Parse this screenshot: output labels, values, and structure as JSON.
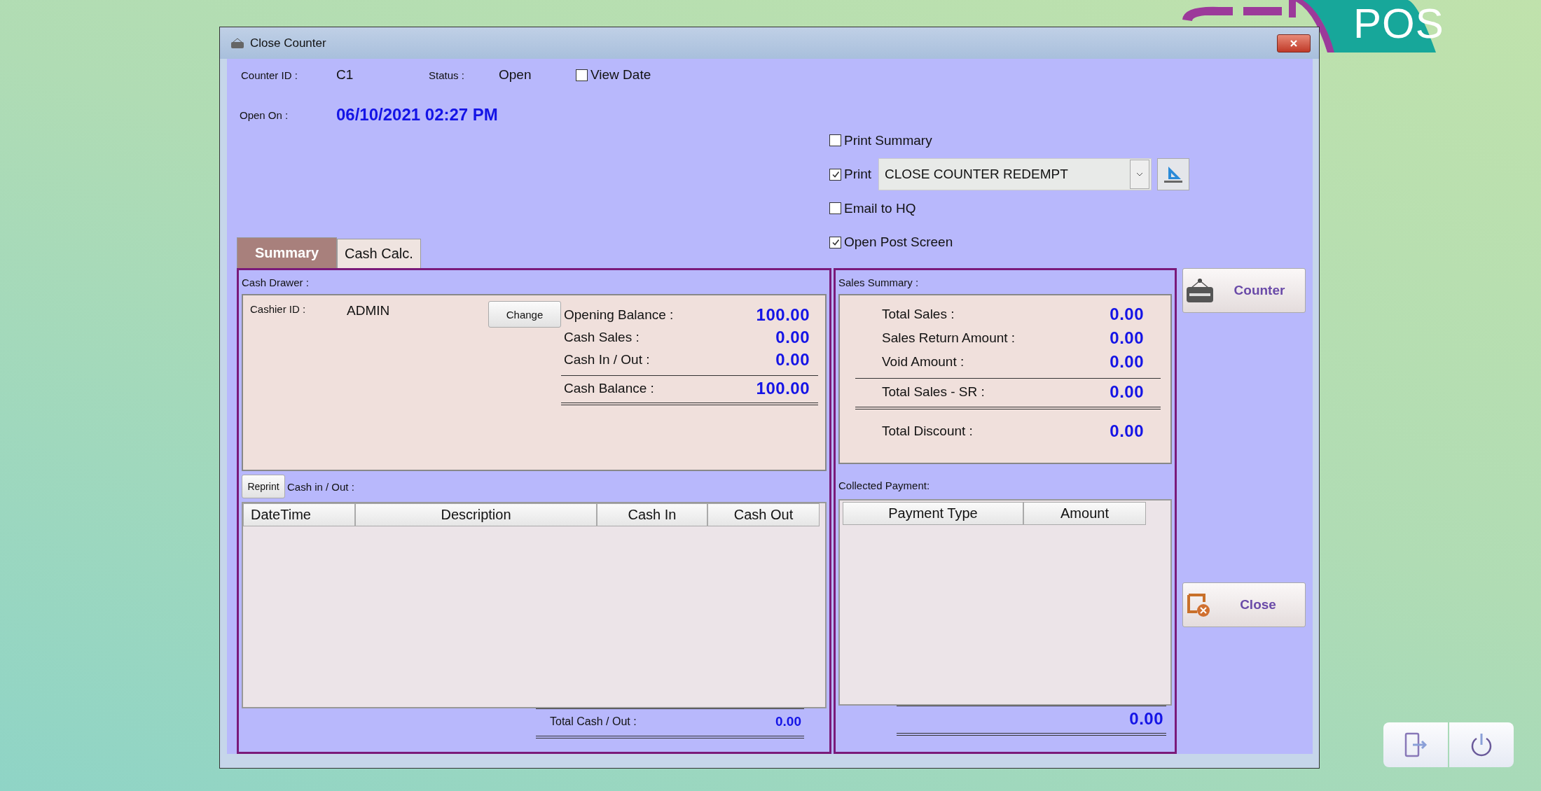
{
  "window": {
    "title": "Close Counter"
  },
  "logo": {
    "text": "POS"
  },
  "header": {
    "counter_id_label": "Counter ID :",
    "counter_id": "C1",
    "status_label": "Status :",
    "status": "Open",
    "view_date": {
      "label": "View Date",
      "checked": false
    },
    "open_on_label": "Open On :",
    "open_on": "06/10/2021 02:27 PM"
  },
  "options": [
    {
      "kind": "checkbox",
      "label": "Print Summary",
      "checked": false
    },
    {
      "kind": "print",
      "label": "Print",
      "checked": true,
      "value": "CLOSE COUNTER REDEMPT"
    },
    {
      "kind": "checkbox",
      "label": "Email to HQ",
      "checked": false
    },
    {
      "kind": "checkbox",
      "label": "Open Post Screen",
      "checked": true
    }
  ],
  "tabs": [
    {
      "label": "Summary",
      "selected": true
    },
    {
      "label": "Cash Calc.",
      "selected": false
    }
  ],
  "cash_drawer": {
    "title": "Cash Drawer :",
    "cashier_label": "Cashier ID :",
    "cashier": "ADMIN",
    "change_button": "Change",
    "lines": [
      {
        "kind": "item",
        "label": "Opening Balance :",
        "value": "100.00"
      },
      {
        "kind": "item",
        "label": "Cash Sales :",
        "value": "0.00"
      },
      {
        "kind": "item",
        "label": "Cash In / Out :",
        "value": "0.00"
      },
      {
        "kind": "total",
        "label": "Cash Balance  :",
        "value": "100.00"
      }
    ]
  },
  "cash_in_out": {
    "reprint_button": "Reprint",
    "title": "Cash in / Out :",
    "columns": [
      "DateTime",
      "Description",
      "Cash In",
      "Cash Out"
    ],
    "total_label": "Total Cash / Out :",
    "total": "0.00"
  },
  "sales_summary": {
    "title": "Sales Summary :",
    "lines": [
      {
        "kind": "item",
        "label": "Total Sales :",
        "value": "0.00"
      },
      {
        "kind": "item",
        "label": "Sales Return Amount :",
        "value": "0.00"
      },
      {
        "kind": "item",
        "label": "Void Amount :",
        "value": "0.00"
      },
      {
        "kind": "total",
        "label": "Total Sales - SR :",
        "value": "0.00"
      },
      {
        "kind": "item",
        "label": "Total Discount :",
        "value": "0.00"
      }
    ]
  },
  "collected_payment": {
    "title": "Collected Payment:",
    "columns": [
      "Payment Type",
      "Amount"
    ],
    "total": "0.00"
  },
  "side_buttons": [
    {
      "kind": "counter",
      "label": "Counter"
    },
    {
      "kind": "close",
      "label": "Close"
    }
  ]
}
